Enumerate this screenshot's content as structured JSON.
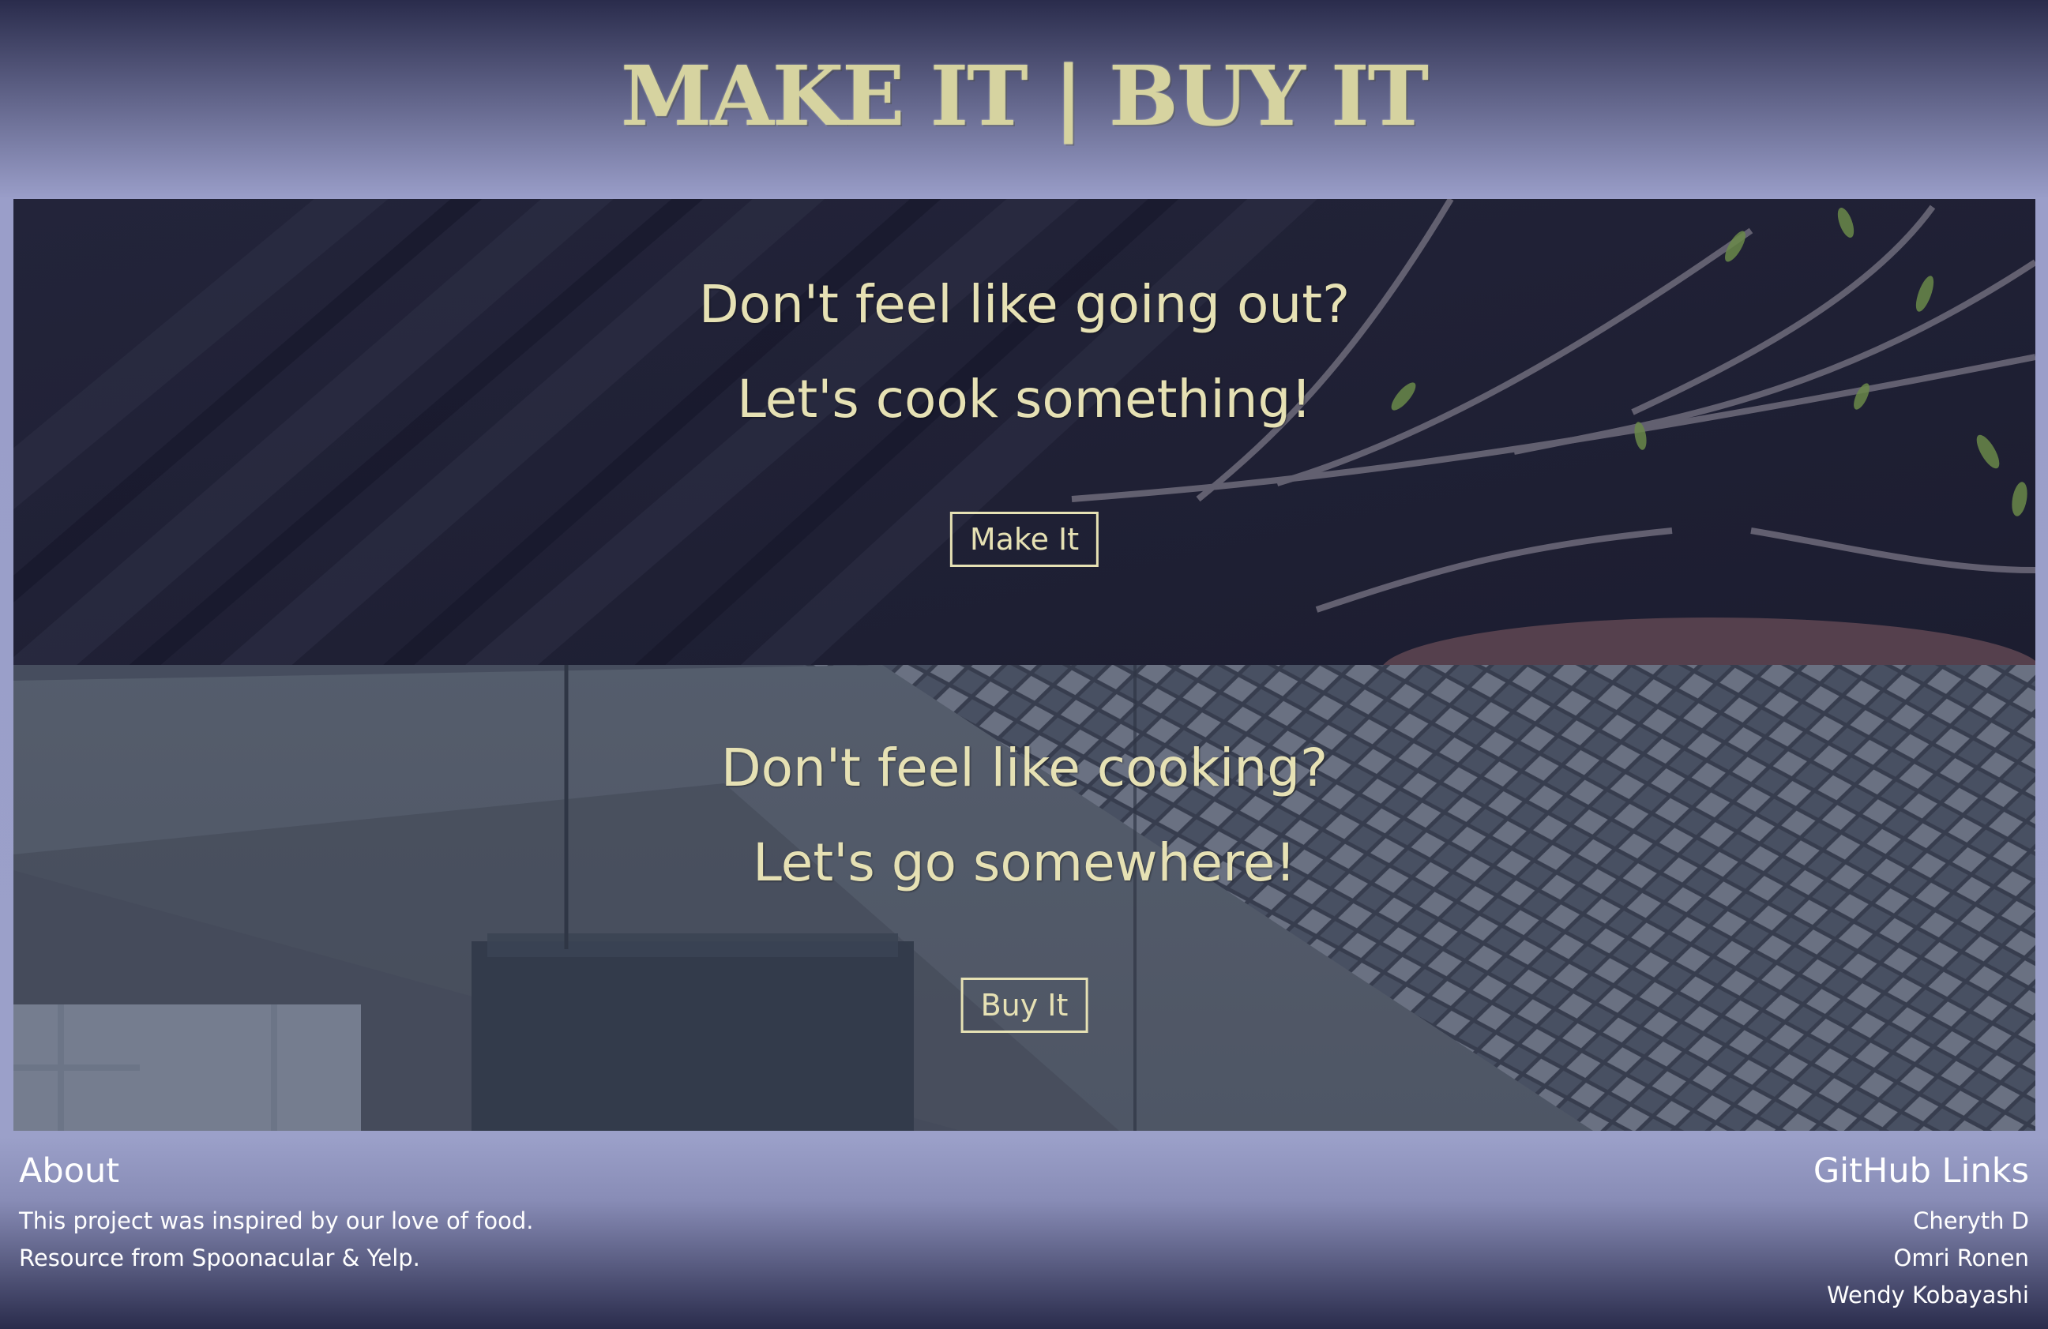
{
  "header": {
    "title": "MAKE IT | BUY IT"
  },
  "make_panel": {
    "headline_1": "Don't feel like going out?",
    "headline_2": "Let's cook something!",
    "button_label": "Make It"
  },
  "buy_panel": {
    "headline_1": "Don't feel like cooking?",
    "headline_2": "Let's go somewhere!",
    "button_label": "Buy It"
  },
  "footer": {
    "about": {
      "heading": "About",
      "lines": [
        "This project was inspired by our love of food.",
        "Resource from Spoonacular & Yelp."
      ]
    },
    "github": {
      "heading": "GitHub Links",
      "links": [
        "Cheryth D",
        "Omri Ronen",
        "Wendy Kobayashi"
      ]
    }
  },
  "colors": {
    "accent_text": "#e6e1b4",
    "title": "#d6d3a0",
    "background_dark": "#2a2c4c",
    "background_light": "#9a9ec9"
  }
}
